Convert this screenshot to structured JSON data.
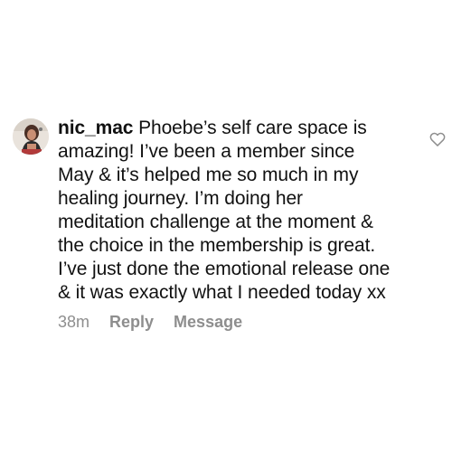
{
  "comment": {
    "username": "nic_mac",
    "text": "Phoebe’s self care space is\namazing!  I’ve been a member since\nMay & it’s helped me so much in my\nhealing journey. I’m doing her\nmeditation challenge at the moment &\nthe choice in the membership is great.\nI’ve just done the emotional release one\n& it was exactly what I needed today xx",
    "time": "38m",
    "reply_label": "Reply",
    "message_label": "Message",
    "like_icon": "heart-outline-icon",
    "colors": {
      "text": "#111111",
      "meta": "#8e8e8e",
      "background": "#ffffff"
    }
  }
}
